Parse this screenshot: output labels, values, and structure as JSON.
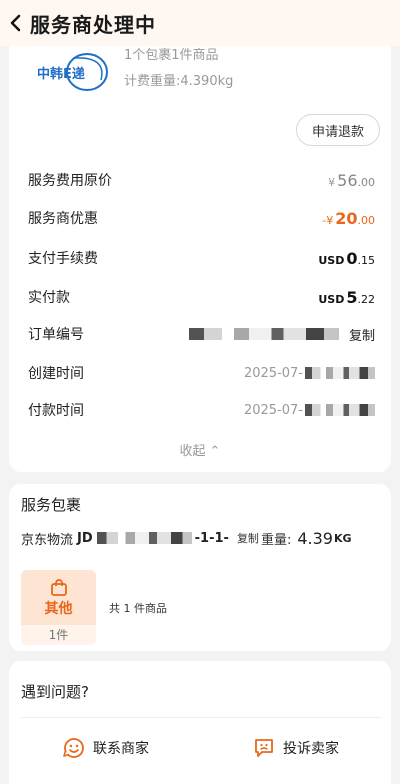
{
  "header": {
    "title": "服务商处理中"
  },
  "package_summary": {
    "count_text": "1个包裹1件商品",
    "weight_text": "计费重量:4.390kg",
    "logo_text": "中韩E递"
  },
  "refund_button": "申请退款",
  "fees": {
    "original": {
      "label": "服务费用原价",
      "symbol": "¥",
      "int": "56",
      "dec": ".00"
    },
    "discount": {
      "label": "服务商优惠",
      "symbol": "-¥",
      "int": "20",
      "dec": ".00"
    },
    "payment_fee": {
      "label": "支付手续费",
      "symbol": "USD",
      "int": "0",
      "dec": ".15"
    },
    "paid": {
      "label": "实付款",
      "symbol": "USD",
      "int": "5",
      "dec": ".22"
    }
  },
  "order": {
    "number_label": "订单编号",
    "copy_label": "复制",
    "created_label": "创建时间",
    "created_prefix": "2025-07-",
    "paid_label": "付款时间",
    "paid_prefix": "2025-07-"
  },
  "collapse_label": "收起",
  "service_package": {
    "title": "服务包裹",
    "carrier": "京东物流",
    "tracking_prefix": "JD",
    "tracking_suffix": "-1-1-",
    "copy_label": "复制",
    "weight_label": "重量:",
    "weight_value": "4.39",
    "weight_unit": "KG",
    "category_name": "其他",
    "category_count": "1件",
    "items_total": "共 1 件商品"
  },
  "help": {
    "title": "遇到问题?",
    "contact_label": "联系商家",
    "complain_label": "投诉卖家"
  },
  "colors": {
    "accent": "#e8671b",
    "tile_bg": "#fde4d3",
    "logo_blue": "#1f6fc5"
  }
}
